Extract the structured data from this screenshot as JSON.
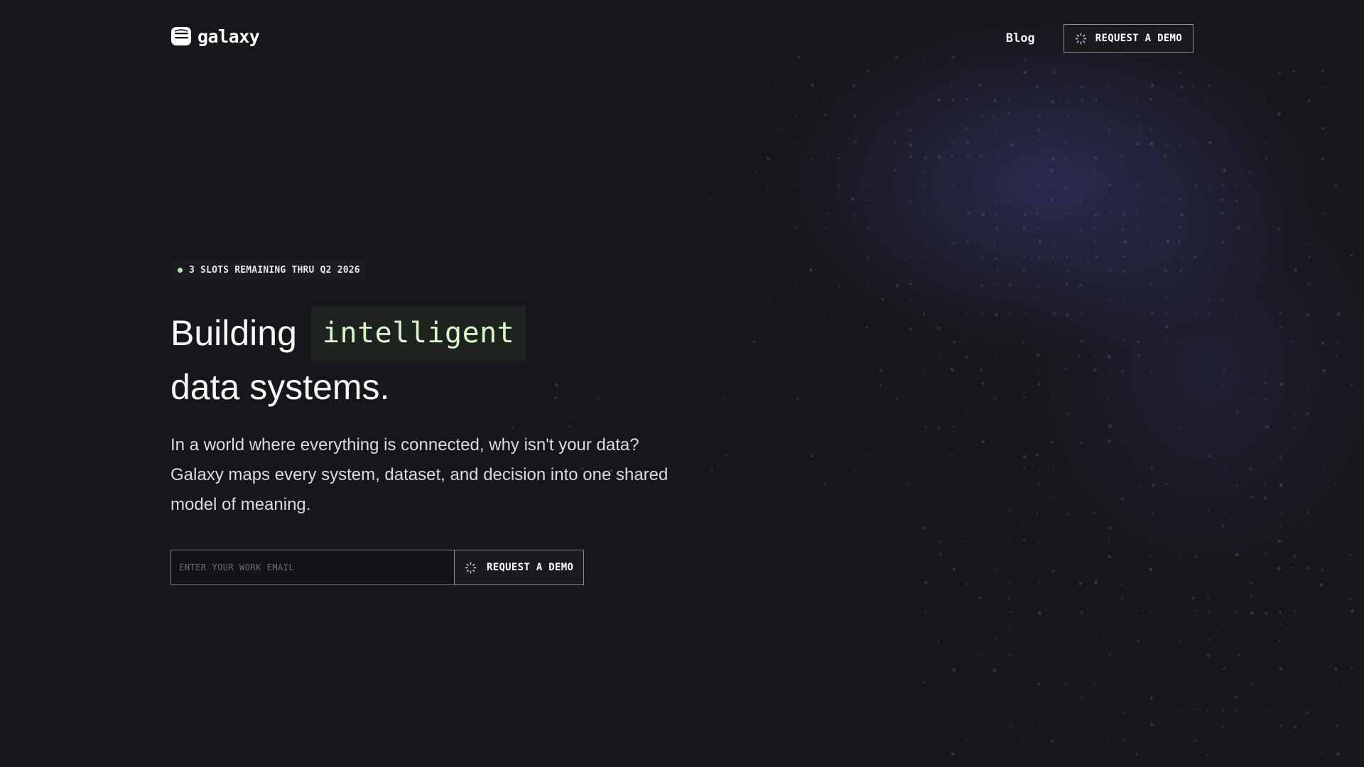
{
  "header": {
    "logo_text": "galaxy",
    "nav_blog": "Blog",
    "cta_label": "REQUEST A DEMO"
  },
  "hero": {
    "badge_text": "3 SLOTS REMAINING THRU Q2 2026",
    "headline_word1": "Building",
    "headline_highlight": "intelligent",
    "headline_line2": "data systems.",
    "subtitle": "In a world where everything is connected, why isn't your data? Galaxy maps every system, dataset, and decision into one shared model of meaning."
  },
  "signup": {
    "email_placeholder": "ENTER YOUR WORK EMAIL",
    "email_value": "",
    "cta_label": "REQUEST A DEMO"
  },
  "icons": {
    "logo": "database-stack-icon",
    "button": "loading-spinner-icon",
    "badge": "status-dot-icon"
  },
  "colors": {
    "background": "#17161a",
    "accent_green": "#bfe9b4",
    "highlight_text": "#d9f6cf",
    "dot_field": "#4a4d8c"
  }
}
